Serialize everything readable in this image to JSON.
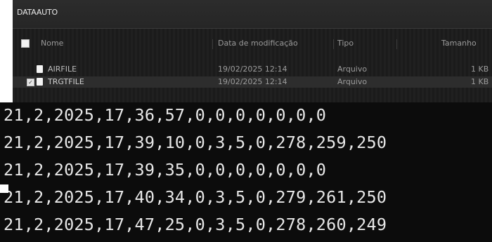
{
  "explorer": {
    "path": "DATAAUTO",
    "columns": {
      "name": "Nome",
      "date": "Data de modificação",
      "type": "Tipo",
      "size": "Tamanho"
    },
    "files": [
      {
        "name": "AIRFILE",
        "date": "19/02/2025 12:14",
        "type": "Arquivo",
        "size": "1 KB",
        "selected": false
      },
      {
        "name": "TRGTFILE",
        "date": "19/02/2025 12:14",
        "type": "Arquivo",
        "size": "1 KB",
        "selected": true
      }
    ]
  },
  "console": {
    "lines": [
      "21,2,2025,17,36,57,0,0,0,0,0,0,0",
      "21,2,2025,17,39,10,0,3,5,0,278,259,250",
      "21,2,2025,17,39,35,0,0,0,0,0,0,0",
      "21,2,2025,17,40,34,0,3,5,0,279,261,250",
      "21,2,2025,17,47,25,0,3,5,0,278,260,249"
    ]
  }
}
